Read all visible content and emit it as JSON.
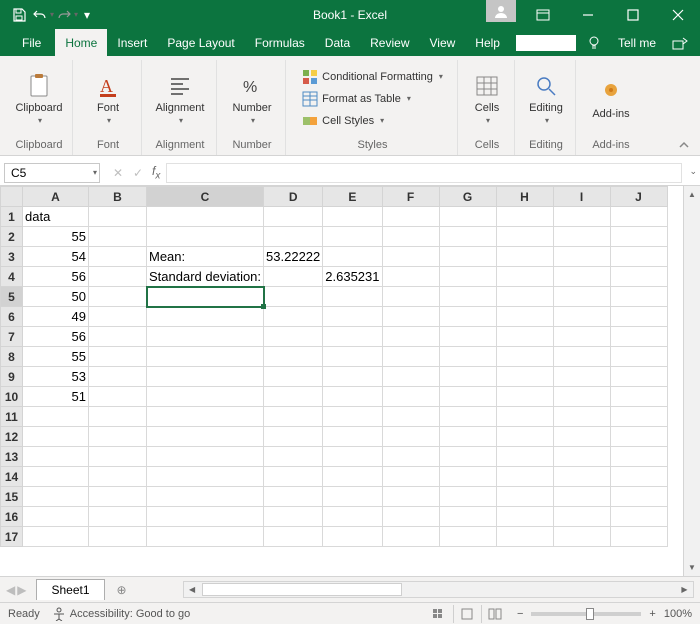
{
  "title": "Book1 - Excel",
  "tabs": {
    "file": "File",
    "home": "Home",
    "insert": "Insert",
    "page_layout": "Page Layout",
    "formulas": "Formulas",
    "data": "Data",
    "review": "Review",
    "view": "View",
    "help": "Help"
  },
  "tellme": "Tell me",
  "ribbon": {
    "clipboard": "Clipboard",
    "font": "Font",
    "alignment": "Alignment",
    "number": "Number",
    "styles": "Styles",
    "cells": "Cells",
    "editing": "Editing",
    "addins": "Add-ins",
    "cond_fmt": "Conditional Formatting",
    "as_table": "Format as Table",
    "cell_styles": "Cell Styles"
  },
  "namebox": "C5",
  "columns": [
    "A",
    "B",
    "C",
    "D",
    "E",
    "F",
    "G",
    "H",
    "I",
    "J"
  ],
  "rows": [
    "1",
    "2",
    "3",
    "4",
    "5",
    "6",
    "7",
    "8",
    "9",
    "10",
    "11",
    "12",
    "13",
    "14",
    "15",
    "16",
    "17"
  ],
  "cells": {
    "A1": "data",
    "A2": "55",
    "A3": "54",
    "A4": "56",
    "A5": "50",
    "A6": "49",
    "A7": "56",
    "A8": "55",
    "A9": "53",
    "A10": "51",
    "C3": "Mean:",
    "D3": "53.22222",
    "C4": "Standard deviation:",
    "E4": "2.635231"
  },
  "active_cell": "C5",
  "sheet": "Sheet1",
  "status": {
    "ready": "Ready",
    "acc": "Accessibility: Good to go",
    "zoom": "100%"
  }
}
